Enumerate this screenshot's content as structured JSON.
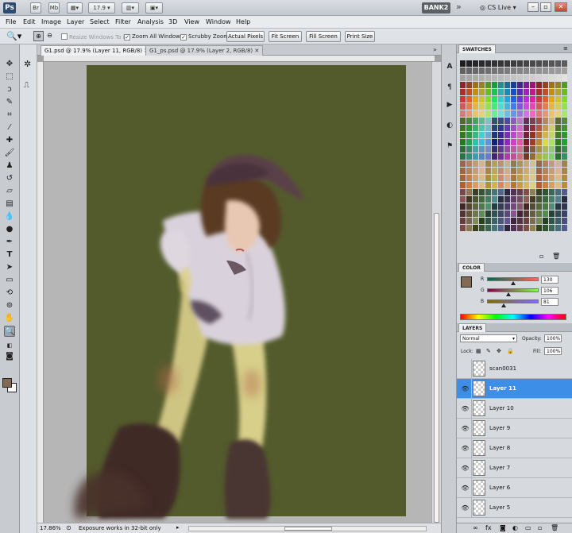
{
  "app": {
    "logo": "Ps",
    "title_buttons": [
      "Br",
      "Mb"
    ],
    "zoom_level": "17.9",
    "workspace": "BANK2",
    "workspace_more": "»",
    "cs_live": "CS Live"
  },
  "menu": [
    "File",
    "Edit",
    "Image",
    "Layer",
    "Select",
    "Filter",
    "Analysis",
    "3D",
    "View",
    "Window",
    "Help"
  ],
  "options": {
    "resize_windows": "Resize Windows To Fit",
    "zoom_all": "Zoom All Windows",
    "scrubby_zoom": "Scrubby Zoom",
    "actual_pixels": "Actual Pixels",
    "fit_screen": "Fit Screen",
    "fill_screen": "Fill Screen",
    "print_size": "Print Size"
  },
  "document": {
    "tabs": [
      {
        "label": "G1.psd @ 17.9% (Layer 11, RGB/8)",
        "active": true
      },
      {
        "label": "G1_ps.psd @ 17.9% (Layer 2, RGB/8)",
        "active": false
      }
    ],
    "status_zoom": "17.86%",
    "status_text": "Exposure works in 32-bit only",
    "canvas_bg": "#535b2c"
  },
  "panels": {
    "swatches_title": "SWATCHES",
    "color_title": "COLOR",
    "layers_title": "LAYERS",
    "color": {
      "fg_color": "#826a55",
      "channels": [
        {
          "label": "R",
          "value": "130",
          "fraction": 0.51
        },
        {
          "label": "G",
          "value": "106",
          "fraction": 0.42
        },
        {
          "label": "B",
          "value": "81",
          "fraction": 0.32
        }
      ]
    },
    "layers": {
      "blend_mode": "Normal",
      "opacity_label": "Opacity:",
      "opacity_value": "100%",
      "lock_label": "Lock:",
      "fill_label": "Fill:",
      "fill_value": "100%",
      "items": [
        {
          "name": "scan0031",
          "visible": false,
          "selected": false
        },
        {
          "name": "Layer 11",
          "visible": true,
          "selected": true
        },
        {
          "name": "Layer 10",
          "visible": true,
          "selected": false
        },
        {
          "name": "Layer 9",
          "visible": true,
          "selected": false
        },
        {
          "name": "Layer 8",
          "visible": true,
          "selected": false
        },
        {
          "name": "Layer 7",
          "visible": true,
          "selected": false
        },
        {
          "name": "Layer 6",
          "visible": true,
          "selected": false
        },
        {
          "name": "Layer 5",
          "visible": true,
          "selected": false
        }
      ]
    }
  }
}
